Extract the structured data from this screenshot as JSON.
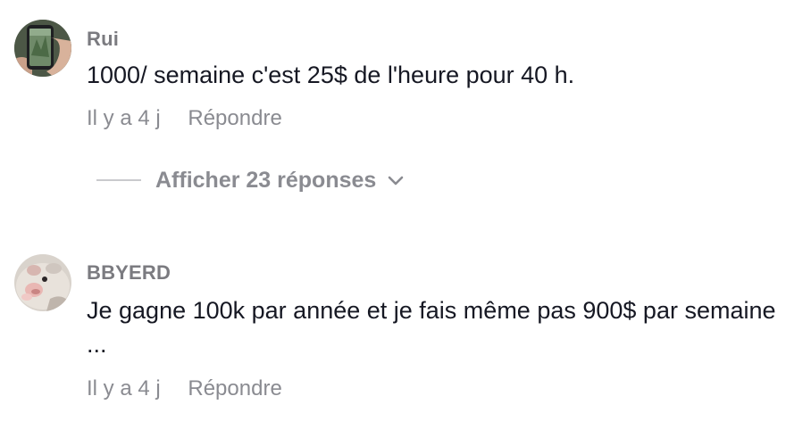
{
  "comments": [
    {
      "username": "Rui",
      "text": "1000/ semaine c'est 25$ de l'heure pour 40 h.",
      "time": "Il y a 4 j",
      "reply_label": "Répondre",
      "avatar_icon": "phone-photo-avatar"
    },
    {
      "username": "BBYERD",
      "text": "Je gagne 100k par année et je fais même pas 900$ par semaine ...",
      "time": "Il y a 4 j",
      "reply_label": "Répondre",
      "avatar_icon": "hamster-avatar"
    }
  ],
  "replies_toggle": {
    "label": "Afficher 23 réponses",
    "icon": "chevron-down-icon"
  },
  "colors": {
    "text": "#161823",
    "muted": "#8a8b91",
    "username": "#7b7b80",
    "divider": "#c9cacd"
  }
}
